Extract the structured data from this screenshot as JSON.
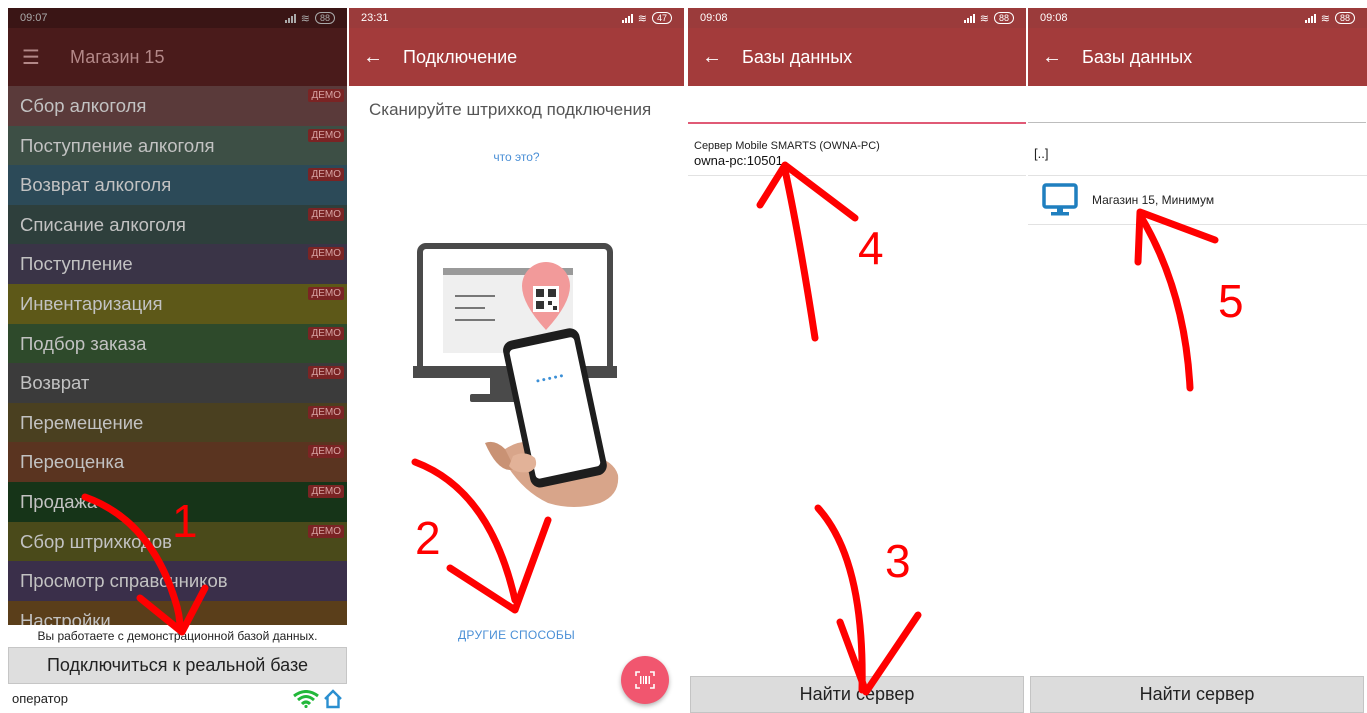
{
  "panel1": {
    "status": {
      "time": "09:07",
      "battery": "88"
    },
    "title": "Магазин 15",
    "menu_items": [
      {
        "label": "Сбор алкоголя",
        "badge": "ДЕМО",
        "bg": "#5a3a3a"
      },
      {
        "label": "Поступление алкоголя",
        "badge": "ДЕМО",
        "bg": "#3d4f45"
      },
      {
        "label": "Возврат алкоголя",
        "badge": "ДЕМО",
        "bg": "#2c4a58"
      },
      {
        "label": "Списание алкоголя",
        "badge": "ДЕМО",
        "bg": "#2e3f3c"
      },
      {
        "label": "Поступление",
        "badge": "ДЕМО",
        "bg": "#3a3447"
      },
      {
        "label": "Инвентаризация",
        "badge": "ДЕМО",
        "bg": "#5d5818"
      },
      {
        "label": "Подбор заказа",
        "badge": "ДЕМО",
        "bg": "#2e4a2b"
      },
      {
        "label": "Возврат",
        "badge": "ДЕМО",
        "bg": "#3b3b3b"
      },
      {
        "label": "Перемещение",
        "badge": "ДЕМО",
        "bg": "#4a4020"
      },
      {
        "label": "Переоценка",
        "badge": "ДЕМО",
        "bg": "#5a3420"
      },
      {
        "label": "Продажа",
        "badge": "ДЕМО",
        "bg": "#163418"
      },
      {
        "label": "Сбор штрихкодов",
        "badge": "ДЕМО",
        "bg": "#4a4a1a"
      },
      {
        "label": "Просмотр справочников",
        "badge": "",
        "bg": "#3a2f4a"
      },
      {
        "label": "Настройки",
        "badge": "",
        "bg": "#5a3e1a"
      }
    ],
    "notice": "Вы работаете с демонстрационной базой данных.",
    "connect_button": "Подключиться к реальной базе",
    "footer_user": "оператор"
  },
  "panel2": {
    "status": {
      "time": "23:31",
      "battery": "47"
    },
    "title": "Подключение",
    "scan_title": "Сканируйте штрихкод подключения",
    "what_link": "что это?",
    "other_link": "ДРУГИЕ СПОСОБЫ"
  },
  "panel3": {
    "status": {
      "time": "09:08",
      "battery": "88"
    },
    "title": "Базы данных",
    "server_line1": "Сервер Mobile SMARTS (OWNA-PC)",
    "server_line2": "owna-pc:10501",
    "find_button": "Найти сервер"
  },
  "panel4": {
    "status": {
      "time": "09:08",
      "battery": "88"
    },
    "title": "Базы данных",
    "parent_item": "[..]",
    "db_item": "Магазин 15, Минимум",
    "find_button": "Найти сервер"
  },
  "annotations": {
    "n1": "1",
    "n2": "2",
    "n3": "3",
    "n4": "4",
    "n5": "5"
  },
  "colors": {
    "appbar": "#a33b3b",
    "annotation": "#ff0000",
    "link": "#4a8fd6",
    "fab": "#f1566f",
    "monitor_icon": "#1f7fbf"
  }
}
